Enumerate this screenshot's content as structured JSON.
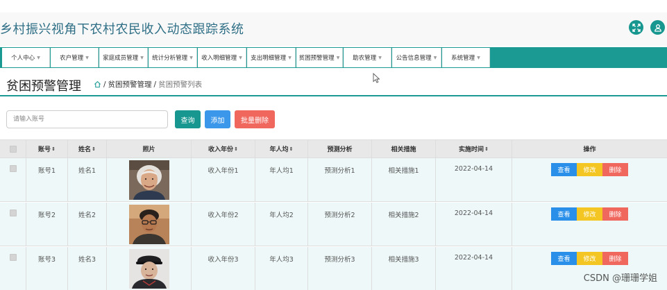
{
  "app": {
    "title": "乡村振兴视角下农村农民收入动态跟踪系统"
  },
  "header_icons": [
    "fullscreen-icon",
    "user-icon"
  ],
  "nav": {
    "items": [
      {
        "label": "个人中心"
      },
      {
        "label": "农户管理"
      },
      {
        "label": "家庭成员管理"
      },
      {
        "label": "统计分析管理"
      },
      {
        "label": "收入明细管理"
      },
      {
        "label": "支出明细管理"
      },
      {
        "label": "贫困预警管理"
      },
      {
        "label": "助农管理"
      },
      {
        "label": "公告信息管理"
      },
      {
        "label": "系统管理"
      }
    ],
    "caret": "▼"
  },
  "page": {
    "title": "贫困预警管理",
    "breadcrumb": {
      "sep": "/",
      "item1": "贫困预警管理",
      "item2": "贫困预警列表"
    }
  },
  "search": {
    "placeholder": "请输入账号",
    "query_label": "查询",
    "add_label": "添加",
    "batch_delete_label": "批量删除"
  },
  "table": {
    "headers": {
      "account": "账号",
      "name": "姓名",
      "photo": "照片",
      "income_year": "收入年份",
      "per_capita": "年人均",
      "forecast": "预测分析",
      "measures": "相关措施",
      "time": "实施时间",
      "ops": "操作"
    },
    "sort_icon": "⇕",
    "rows": [
      {
        "account": "账号1",
        "name": "姓名1",
        "photo": "photo-elderly-woman",
        "income_year": "收入年份1",
        "per_capita": "年人均1",
        "forecast": "预测分析1",
        "measures": "相关措施1",
        "time": "2022-04-14"
      },
      {
        "account": "账号2",
        "name": "姓名2",
        "photo": "photo-man-with-glasses",
        "income_year": "收入年份2",
        "per_capita": "年人均2",
        "forecast": "预测分析2",
        "measures": "相关措施2",
        "time": "2022-04-14"
      },
      {
        "account": "账号3",
        "name": "姓名3",
        "photo": "photo-woman-in-cap",
        "income_year": "收入年份3",
        "per_capita": "年人均3",
        "forecast": "预测分析3",
        "measures": "相关措施3",
        "time": "2022-04-14"
      }
    ],
    "ops": {
      "view": "查看",
      "edit": "修改",
      "delete": "删除"
    }
  },
  "watermark": "CSDN @珊珊学姐",
  "colors": {
    "primary": "#1b9a94",
    "blue": "#3a97ea",
    "red": "#f0675e",
    "yellow": "#f3c623",
    "title_blue": "#2f6f86",
    "row_bg": "#eef8f8"
  }
}
